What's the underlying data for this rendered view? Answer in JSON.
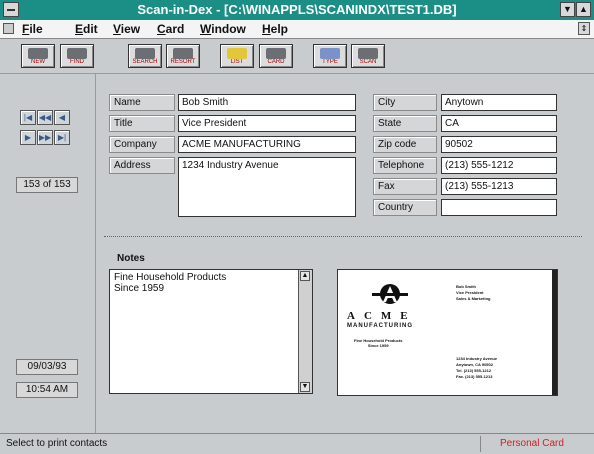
{
  "window": {
    "title": "Scan-in-Dex - [C:\\WINAPPLS\\SCANINDX\\TEST1.DB]",
    "minimize_glyph": "▼",
    "maximize_glyph": "▲"
  },
  "menu": {
    "items": [
      "File",
      "Edit",
      "View",
      "Card",
      "Window",
      "Help"
    ],
    "restore_glyph": "⇕"
  },
  "toolbar": {
    "buttons": [
      "NEW",
      "FIND",
      "SEARCH",
      "RESORT",
      "LIST",
      "CARD",
      "TYPE",
      "SCAN"
    ]
  },
  "nav": {
    "first": "|◀",
    "prev_page": "◀◀",
    "prev": "◀",
    "next": "▶",
    "next_page": "▶▶",
    "last": "▶|",
    "counter": "153 of 153"
  },
  "contact": {
    "labels": {
      "name": "Name",
      "title": "Title",
      "company": "Company",
      "address": "Address",
      "city": "City",
      "state": "State",
      "zip": "Zip code",
      "telephone": "Telephone",
      "fax": "Fax",
      "country": "Country"
    },
    "values": {
      "name": "Bob Smith",
      "title": "Vice President",
      "company": "ACME MANUFACTURING",
      "address": "1234 Industry Avenue",
      "city": "Anytown",
      "state": "CA",
      "zip": "90502",
      "telephone": "(213) 555-1212",
      "fax": "(213) 555-1213",
      "country": ""
    }
  },
  "notes": {
    "title": "Notes",
    "line1": "Fine Household Products",
    "line2": "Since 1959",
    "scroll_up": "▲",
    "scroll_down": "▼"
  },
  "card_image": {
    "brand": "ACME",
    "subbrand": "MANUFACTURING",
    "tagline_1": "Fine Household Products",
    "tagline_2": "Since 1959",
    "name": "Bob Smith",
    "title": "Vice President",
    "dept": "Sales & Marketing",
    "addr_1": "1234 Industry Avenue",
    "addr_2": "Anytown, CA 90502",
    "addr_3": "Tel. (213) 555-1212",
    "addr_4": "Fax. (213) 555-1213"
  },
  "dates": {
    "date": "09/03/93",
    "time": "10:54 AM"
  },
  "status": {
    "message": "Select to print contacts",
    "right": "Personal Card"
  },
  "colors": {
    "titlebar": "#1b8f86",
    "window": "#c9cccf",
    "status_right": "#d02020"
  }
}
